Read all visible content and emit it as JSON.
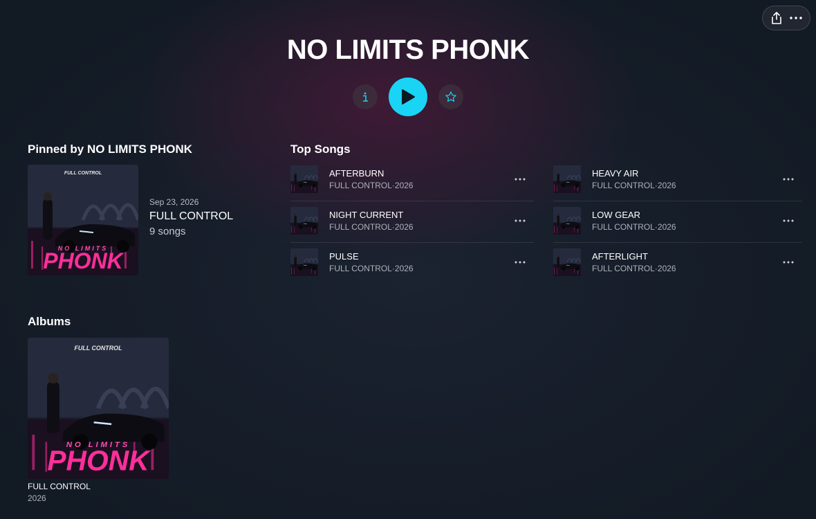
{
  "artist": {
    "name": "NO LIMITS PHONK"
  },
  "controls": {
    "info_icon": "info-icon",
    "play_icon": "play-icon",
    "favorite_icon": "star-icon",
    "accent": "#1ad4f5"
  },
  "toolbar": {
    "share_icon": "share-icon",
    "more_icon": "more-icon"
  },
  "pinned": {
    "section_title": "Pinned by NO LIMITS PHONK",
    "date": "Sep 23, 2026",
    "title": "FULL CONTROL",
    "count": "9 songs",
    "art_top_text": "FULL CONTROL",
    "art_line1": "NO LIMITS",
    "art_line2": "PHONK"
  },
  "top_songs": {
    "section_title": "Top Songs",
    "songs": [
      {
        "title": "AFTERBURN",
        "album": "FULL CONTROL",
        "sep": "·",
        "year": "2026"
      },
      {
        "title": "NIGHT CURRENT",
        "album": "FULL CONTROL",
        "sep": "·",
        "year": "2026"
      },
      {
        "title": "PULSE",
        "album": "FULL CONTROL",
        "sep": "·",
        "year": "2026"
      },
      {
        "title": "HEAVY AIR",
        "album": "FULL CONTROL",
        "sep": "·",
        "year": "2026"
      },
      {
        "title": "LOW GEAR",
        "album": "FULL CONTROL",
        "sep": "·",
        "year": "2026"
      },
      {
        "title": "AFTERLIGHT",
        "album": "FULL CONTROL",
        "sep": "·",
        "year": "2026"
      }
    ]
  },
  "albums": {
    "section_title": "Albums",
    "items": [
      {
        "title": "FULL CONTROL",
        "year": "2026",
        "art_top_text": "FULL CONTROL",
        "art_line1": "NO LIMITS",
        "art_line2": "PHONK"
      }
    ]
  }
}
